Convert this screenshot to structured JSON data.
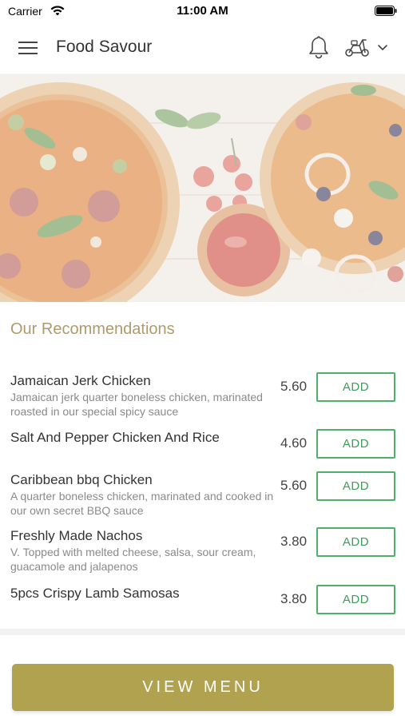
{
  "status_bar": {
    "carrier": "Carrier",
    "time": "11:00 AM"
  },
  "header": {
    "title": "Food Savour",
    "menu_icon": "hamburger-menu-icon",
    "notification_icon": "bell-icon",
    "delivery_icon": "scooter-icon",
    "dropdown_icon": "chevron-down-icon"
  },
  "hero": {
    "image": "pizzas-tomatoes-ketchup"
  },
  "recommendations": {
    "title": "Our Recommendations",
    "items": [
      {
        "name": "Jamaican Jerk Chicken",
        "description": "Jamaican jerk quarter boneless chicken, marinated roasted in our special spicy sauce",
        "price": "5.60",
        "button": "ADD"
      },
      {
        "name": "Salt And Pepper Chicken And Rice",
        "description": "",
        "price": "4.60",
        "button": "ADD"
      },
      {
        "name": "Caribbean bbq Chicken",
        "description": "A quarter boneless chicken, marinated and cooked in our own secret BBQ sauce",
        "price": "5.60",
        "button": "ADD"
      },
      {
        "name": "Freshly Made Nachos",
        "description": "V. Topped with melted cheese, salsa, sour cream, guacamole and jalapenos",
        "price": "3.80",
        "button": "ADD"
      },
      {
        "name": "5pcs Crispy Lamb Samosas",
        "description": "",
        "price": "3.80",
        "button": "ADD"
      }
    ]
  },
  "footer": {
    "view_menu_label": "VIEW MENU"
  },
  "colors": {
    "accent_gold": "#b0a24e",
    "section_title": "#b09a6a",
    "add_green": "#4caf6a"
  }
}
